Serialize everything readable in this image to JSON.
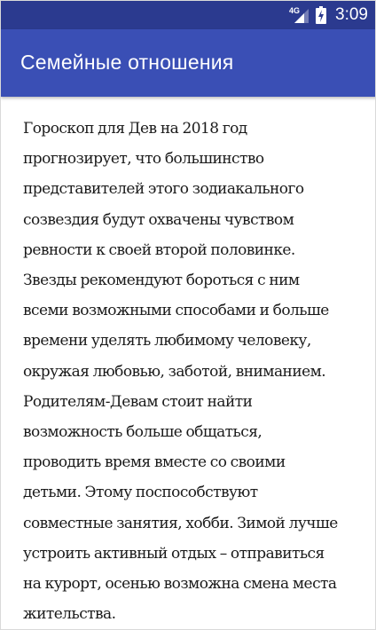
{
  "status_bar": {
    "network_type": "4G",
    "signal_icon": "cell-signal-icon",
    "battery_icon": "battery-charging-icon",
    "time": "3:09"
  },
  "app_bar": {
    "title": "Семейные отношения",
    "color": "#3a4fb5",
    "status_color": "#2b3a8f"
  },
  "article": {
    "lines": [
      "Гороскоп для Дев на 2018 год",
      "прогнозирует, что большинство",
      "представителей этого зодиакального",
      "созвездия будут охвачены чувством",
      "ревности к своей второй половинке.",
      "Звезды рекомендуют бороться с ним",
      "всеми возможными способами и больше",
      "времени уделять любимому человеку,",
      "окружая любовью, заботой, вниманием.",
      "Родителям-Девам стоит найти",
      "возможность больше общаться,",
      "проводить время вместе со своими",
      "детьми. Этому поспособствуют",
      "совместные занятия, хобби. Зимой лучше",
      "устроить активный отдых – отправиться",
      "на курорт, осенью возможна смена места",
      "жительства."
    ]
  }
}
